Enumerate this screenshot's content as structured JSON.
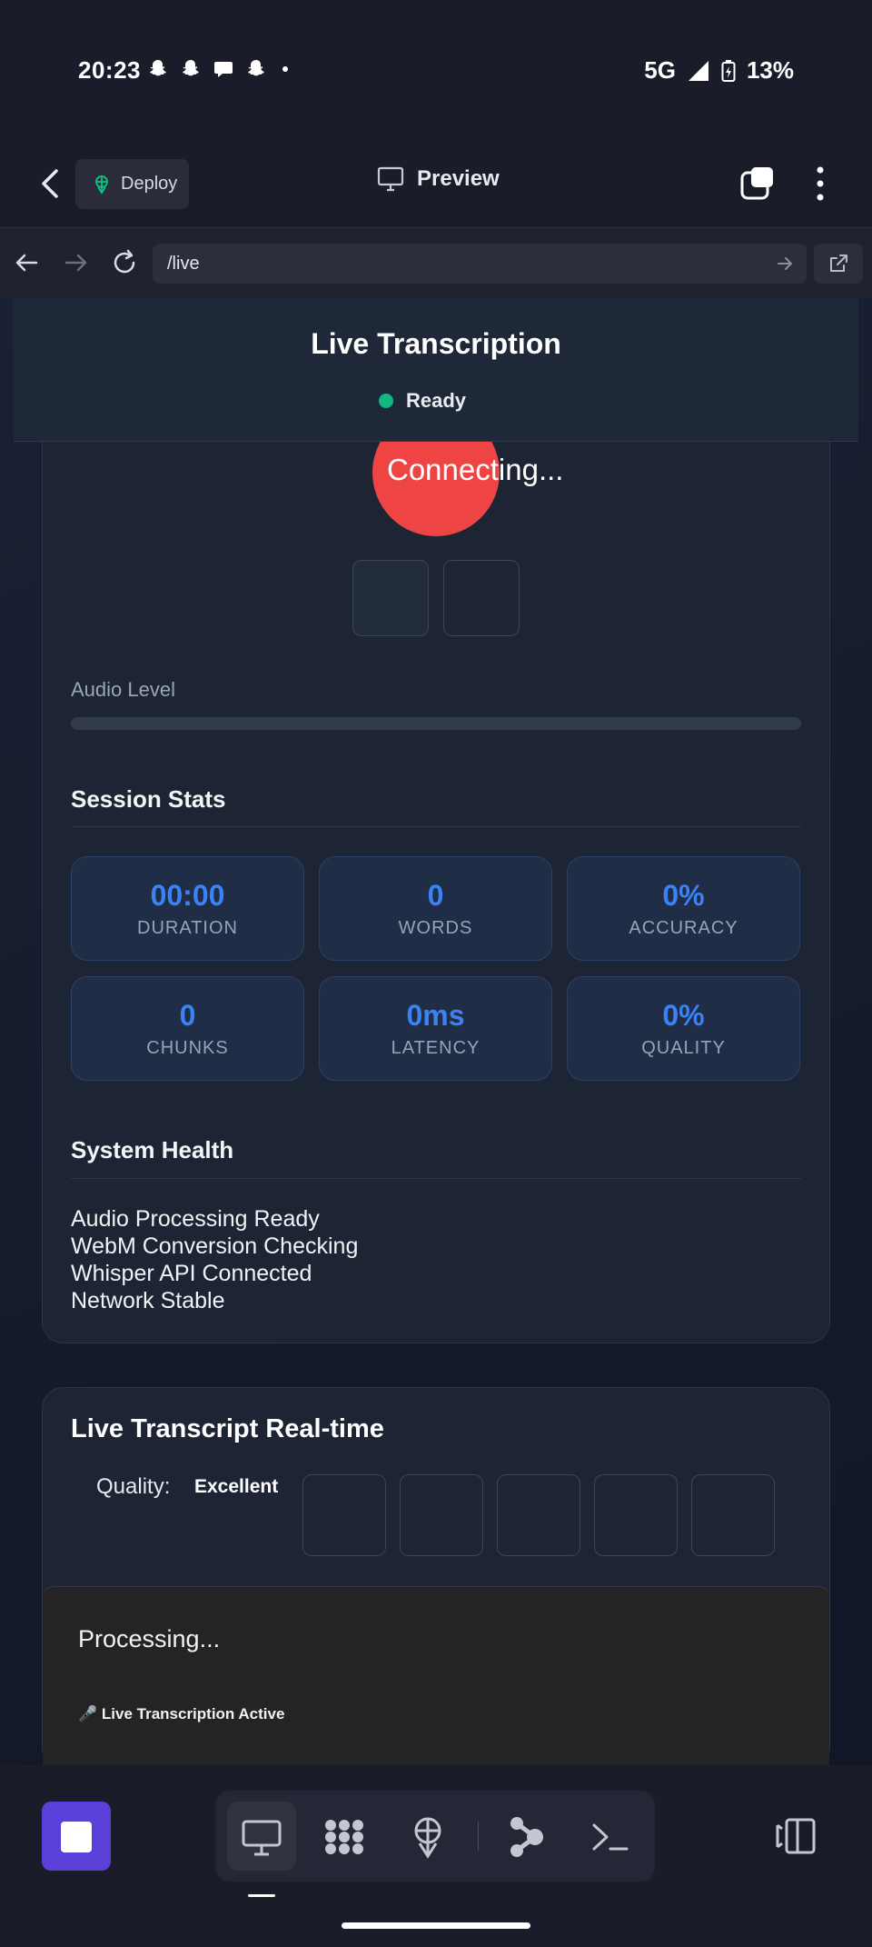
{
  "status_bar": {
    "time": "20:23",
    "network": "5G",
    "battery": "13%",
    "notification_icons": [
      "snapchat-icon",
      "snapchat-icon",
      "chat-icon",
      "snapchat-icon",
      "dot-icon"
    ]
  },
  "app_toolbar": {
    "deploy_label": "Deploy",
    "preview_label": "Preview"
  },
  "browser": {
    "url": "/live"
  },
  "page": {
    "title": "Live Transcription",
    "status": "Ready",
    "record_button_label": "Connecting...",
    "audio_level_label": "Audio Level",
    "audio_level": 0,
    "session_stats_title": "Session Stats",
    "stats": [
      {
        "value": "00:00",
        "label": "DURATION"
      },
      {
        "value": "0",
        "label": "WORDS"
      },
      {
        "value": "0%",
        "label": "ACCURACY"
      },
      {
        "value": "0",
        "label": "CHUNKS"
      },
      {
        "value": "0ms",
        "label": "LATENCY"
      },
      {
        "value": "0%",
        "label": "QUALITY"
      }
    ],
    "system_health_title": "System Health",
    "health_items": [
      "Audio Processing Ready",
      "WebM Conversion Checking",
      "Whisper API Connected",
      "Network Stable"
    ],
    "live_transcript_title": "Live Transcript Real-time",
    "quality_label": "Quality:",
    "quality_value": "Excellent",
    "processing_text": "Processing...",
    "active_note": "🎤 Live Transcription Active"
  },
  "colors": {
    "accent_blue": "#3b82f6",
    "ready_green": "#10b981",
    "record_red": "#ef4444",
    "stop_purple": "#5b3fd9"
  }
}
